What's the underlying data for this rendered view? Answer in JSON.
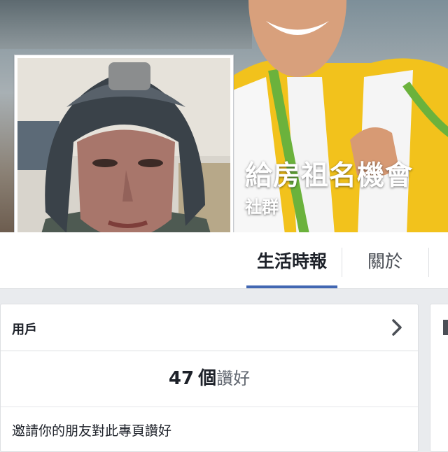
{
  "page": {
    "name": "給房祖名機會",
    "category": "社群"
  },
  "tabs": [
    {
      "label": "生活時報",
      "active": true
    },
    {
      "label": "關於",
      "active": false
    }
  ],
  "users_card": {
    "title": "用戶",
    "likes_count": "47",
    "likes_unit": "個",
    "likes_label": "讚好",
    "invite_text": "邀請你的朋友對此專頁讚好"
  },
  "icons": {
    "card_chevron": "chevron-right-icon"
  },
  "colors": {
    "active_tab_underline": "#4267b2",
    "background": "#e9ebee"
  }
}
